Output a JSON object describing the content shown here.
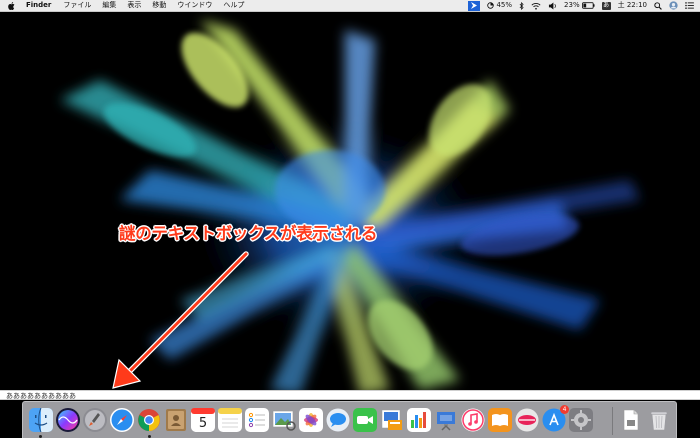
{
  "menubar": {
    "app_name": "Finder",
    "menus": [
      "ファイル",
      "編集",
      "表示",
      "移動",
      "ウインドウ",
      "ヘルプ"
    ],
    "status": {
      "battery_percent_1": "45%",
      "battery_percent_2": "23%",
      "input_method": "あ",
      "clock": "土 22:10"
    }
  },
  "annotation": {
    "text": "謎のテキストボックスが表示される",
    "color": "#ff3a1a"
  },
  "mystery_textbox": {
    "value": "ああああああああああ"
  },
  "dock": {
    "apps": [
      {
        "name": "finder-icon",
        "running": true
      },
      {
        "name": "siri-icon",
        "running": false
      },
      {
        "name": "launchpad-icon",
        "running": false
      },
      {
        "name": "safari-icon",
        "running": false
      },
      {
        "name": "chrome-icon",
        "running": true
      },
      {
        "name": "contacts-icon",
        "running": false
      },
      {
        "name": "calendar-icon",
        "running": false
      },
      {
        "name": "notes-icon",
        "running": false
      },
      {
        "name": "reminders-icon",
        "running": false
      },
      {
        "name": "preview-icon",
        "running": false
      },
      {
        "name": "photos-icon",
        "running": false
      },
      {
        "name": "messages-icon",
        "running": false
      },
      {
        "name": "facetime-icon",
        "running": false
      },
      {
        "name": "keynote-doc-icon",
        "running": false
      },
      {
        "name": "numbers-icon",
        "running": false
      },
      {
        "name": "keynote-icon",
        "running": false
      },
      {
        "name": "itunes-icon",
        "running": false
      },
      {
        "name": "ibooks-icon",
        "running": false
      },
      {
        "name": "linkage-icon",
        "running": false
      },
      {
        "name": "app-store-icon",
        "running": false
      },
      {
        "name": "system-preferences-icon",
        "running": false
      },
      {
        "name": "document-icon",
        "running": false
      },
      {
        "name": "trash-icon",
        "running": false
      }
    ],
    "calendar_day": "5",
    "app_store_badge": "4"
  }
}
